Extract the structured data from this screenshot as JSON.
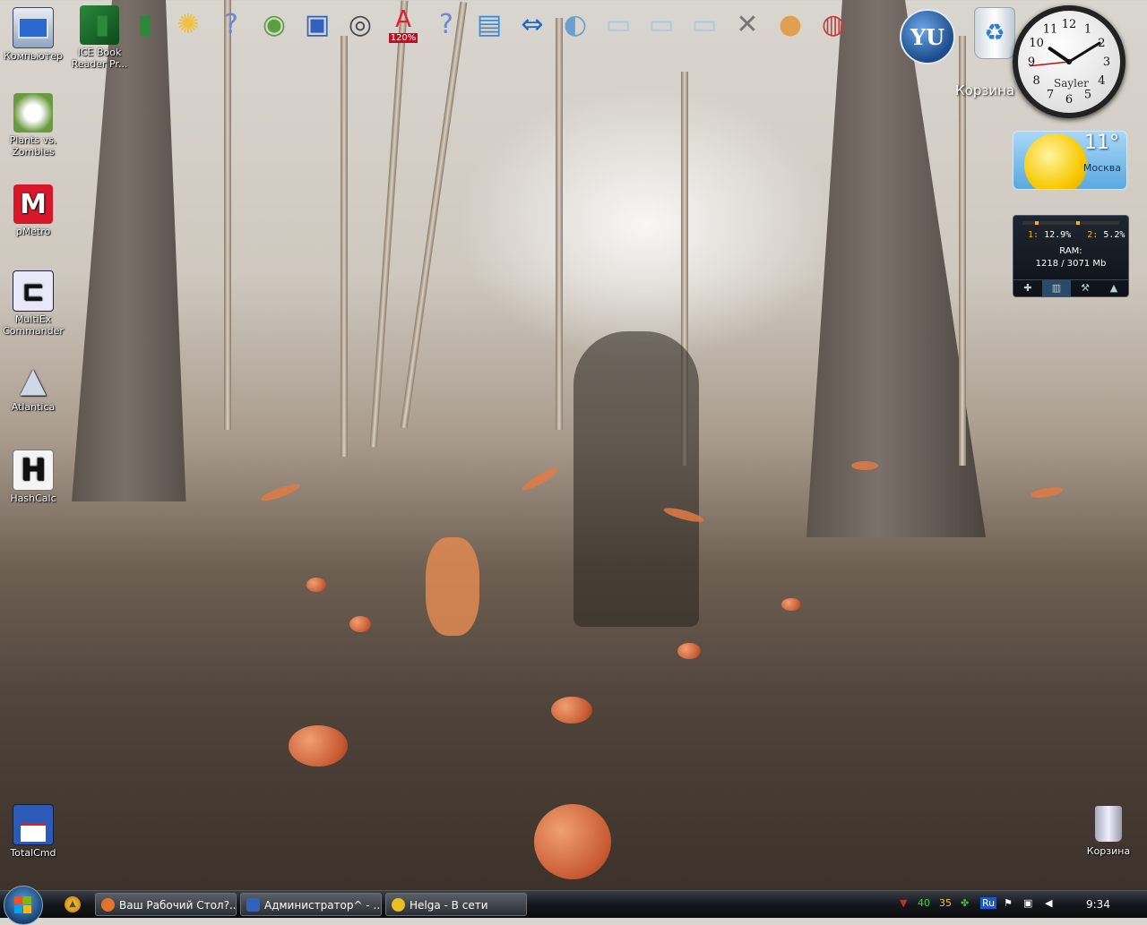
{
  "desktop_icons": [
    {
      "label": "Компьютер",
      "icon": "computer-icon"
    },
    {
      "label": "Plants vs. Zombies",
      "icon": "game-icon"
    },
    {
      "label": "pMetro",
      "icon": "metro-icon"
    },
    {
      "label": "MultiEx Commander",
      "icon": "multiex-icon"
    },
    {
      "label": "Atlantica",
      "icon": "atlantica-icon"
    },
    {
      "label": "HashCalc",
      "icon": "hashcalc-icon"
    },
    {
      "label": "TotalCmd",
      "icon": "floppy-icon"
    },
    {
      "label": "ICE Book Reader Pr...",
      "icon": "book-icon"
    },
    {
      "label": "Корзина",
      "icon": "recycle-bin-icon"
    }
  ],
  "dock": {
    "items": [
      "book-icon",
      "book-icon",
      "sparkle-icon",
      "help-icon",
      "globe-icon",
      "floppy-icon",
      "camera-icon",
      "zoom-icon",
      "help-icon",
      "rdp-icon",
      "teamviewer-icon",
      "network-icon",
      "folder-icon",
      "folder-icon",
      "folder-icon",
      "tools-icon",
      "pig-icon",
      "shield-icon"
    ],
    "zoom_label": "120%",
    "yu_label": "YU",
    "bin_label": "Корзина"
  },
  "clock": {
    "brand": "Sayler",
    "hour": 10,
    "minute": 9,
    "second": 44
  },
  "weather": {
    "temperature": "11°",
    "city": "Москва"
  },
  "meter": {
    "core1_label": "1:",
    "core1_value": "12.9%",
    "core2_label": "2:",
    "core2_value": "5.2%",
    "ram_title": "RAM:",
    "ram_value": "1218 / 3071 Mb",
    "core1_fraction": 0.129,
    "core2_fraction": 0.052
  },
  "taskbar": {
    "tasks": [
      {
        "label": "Ваш Рабочий Стол?...",
        "icon": "firefox-icon",
        "color": "#e0762a"
      },
      {
        "label": "Администратор^ - ...",
        "icon": "floppy-icon",
        "color": "#3060c0"
      },
      {
        "label": "Helga - В сети",
        "icon": "qip-icon",
        "color": "#e8c020"
      }
    ],
    "tray": {
      "num1": "40",
      "num2": "35",
      "lang": "Ru"
    },
    "time": "9:34"
  },
  "colors": {
    "accent": "#2f7fd0",
    "taskbar": "#15181c",
    "orange": "#e07a45"
  }
}
